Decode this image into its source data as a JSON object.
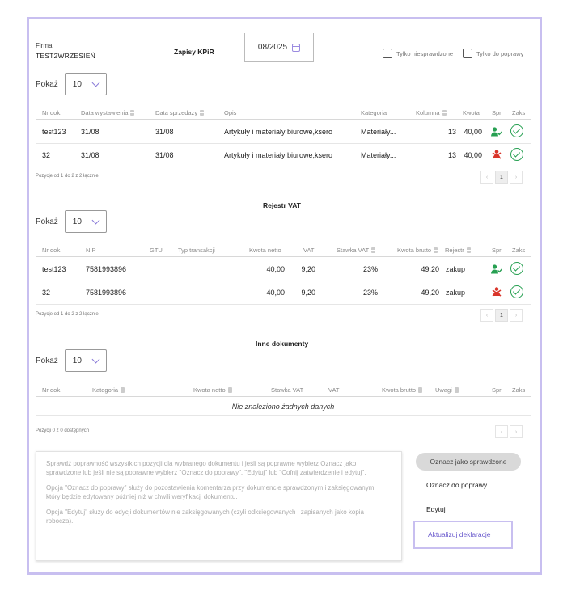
{
  "header": {
    "firma_label": "Firma:",
    "firma_value": "TEST2WRZESIEŃ",
    "title": "Zapisy KPiR",
    "period": "08/2025",
    "filter_unchecked": "Tylko niesprawdzone",
    "filter_to_fix": "Tylko do poprawy"
  },
  "show_label": "Pokaż",
  "show_value": "10",
  "kpir": {
    "columns": [
      "Nr dok.",
      "Data wystawienia",
      "Data sprzedaży",
      "Opis",
      "Kategoria",
      "Kolumna",
      "Kwota",
      "Spr",
      "Zaks"
    ],
    "rows": [
      {
        "nr": "test123",
        "data_wyst": "31/08",
        "data_sprz": "31/08",
        "opis": "Artykuły i materiały biurowe,ksero",
        "kategoria": "Materiały...",
        "kolumna": "13",
        "kwota": "40,00",
        "spr": "user-check-icon",
        "zaks": "check-circle-icon"
      },
      {
        "nr": "32",
        "data_wyst": "31/08",
        "data_sprz": "31/08",
        "opis": "Artykuły i materiały biurowe,ksero",
        "kategoria": "Materiały...",
        "kolumna": "13",
        "kwota": "40,00",
        "spr": "user-x-icon",
        "zaks": "check-circle-icon"
      }
    ],
    "footer": "Pozycje od 1 do 2 z 2 łącznie",
    "page": "1"
  },
  "vat": {
    "title": "Rejestr VAT",
    "columns": [
      "Nr dok.",
      "NIP",
      "GTU",
      "Typ transakcji",
      "Kwota netto",
      "VAT",
      "Stawka VAT",
      "Kwota brutto",
      "Rejestr",
      "Spr",
      "Zaks"
    ],
    "rows": [
      {
        "nr": "test123",
        "nip": "7581993896",
        "netto": "40,00",
        "vat": "9,20",
        "stawka": "23%",
        "brutto": "49,20",
        "rejestr": "zakup",
        "spr": "user-check-icon",
        "zaks": "check-circle-icon"
      },
      {
        "nr": "32",
        "nip": "7581993896",
        "netto": "40,00",
        "vat": "9,20",
        "stawka": "23%",
        "brutto": "49,20",
        "rejestr": "zakup",
        "spr": "user-x-icon",
        "zaks": "check-circle-icon"
      }
    ],
    "footer": "Pozycje od 1 do 2 z 2 łącznie",
    "page": "1"
  },
  "inne": {
    "title": "Inne dokumenty",
    "columns": [
      "Nr dok.",
      "Kategoria",
      "Kwota netto",
      "Stawka VAT",
      "VAT",
      "Kwota brutto",
      "Uwagi",
      "Spr",
      "Zaks"
    ],
    "empty": "Nie znaleziono żadnych danych",
    "footer": "Pozycji 0 z 0 dostępnych"
  },
  "info": {
    "p1": "Sprawdź poprawność wszystkich pozycji dla wybranego dokumentu i jeśli są poprawne wybierz Oznacz jako sprawdzone lub jeśli nie są poprawne wybierz \"Oznacz do poprawy\", \"Edytuj\" lub \"Cofnij zatwierdzenie i edytuj\".",
    "p2": "Opcja \"Oznacz do poprawy\" służy do pozostawienia komentarza przy dokumencie sprawdzonym i zaksięgowanym, który będzie edytowany później niż w chwili weryfikacji dokumentu.",
    "p3": "Opcja \"Edytuj\" służy do edycji dokumentów nie zaksięgowanych (czyli odksięgowanych i zapisanych jako kopia robocza)."
  },
  "actions": {
    "mark_checked": "Oznacz jako sprawdzone",
    "mark_fix": "Oznacz do poprawy",
    "edit": "Edytuj",
    "update": "Aktualizuj deklaracje"
  },
  "colors": {
    "accent": "#c8bff0",
    "ok": "#27a052",
    "bad": "#d9352b"
  }
}
